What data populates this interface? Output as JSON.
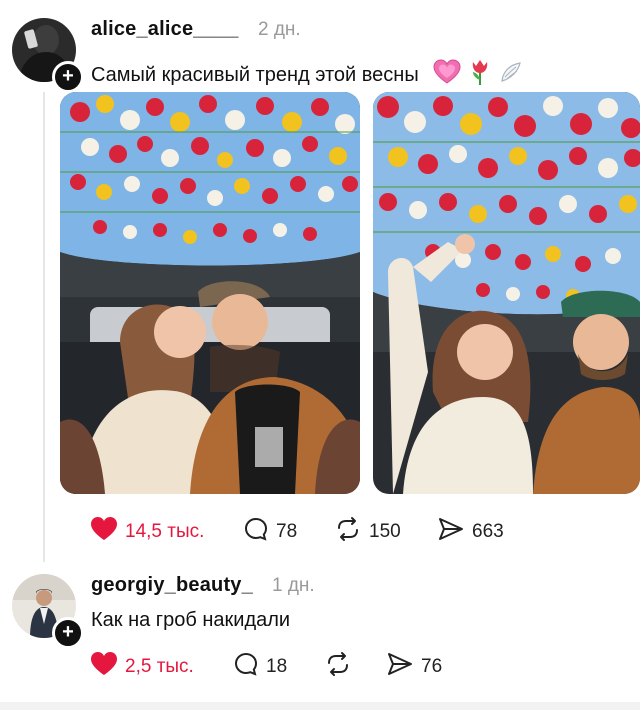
{
  "post": {
    "username": "alice_alice____",
    "time": "2 дн.",
    "text": "Самый красивый тренд этой весны",
    "emoji_icons": [
      "pink-heart-icon",
      "tulip-icon",
      "wing-icon"
    ],
    "photos": [
      {
        "name": "photo-couple-kissing",
        "desc": "tulip-covered panoramic car roof, couple kissing"
      },
      {
        "name": "photo-couple-selfie",
        "desc": "tulip-covered panoramic car roof, couple selfie"
      }
    ],
    "likes": "14,5 тыс.",
    "comments": "78",
    "reposts": "150",
    "shares": "663"
  },
  "reply": {
    "username": "georgiy_beauty_",
    "time": "1 дн.",
    "text": "Как на гроб накидали",
    "likes": "2,5 тыс.",
    "comments": "18",
    "shares": "76"
  },
  "colors": {
    "like_red": "#e5173f",
    "muted_gray": "#9a9a9a",
    "text_dark": "#111111"
  }
}
